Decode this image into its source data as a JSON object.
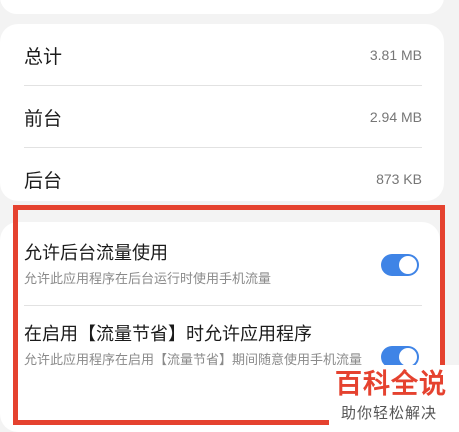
{
  "usage": {
    "rows": [
      {
        "label": "总计",
        "value": "3.81 MB"
      },
      {
        "label": "前台",
        "value": "2.94 MB"
      },
      {
        "label": "后台",
        "value": "873 KB"
      }
    ]
  },
  "settings": {
    "items": [
      {
        "title": "允许后台流量使用",
        "description": "允许此应用程序在后台运行时使用手机流量",
        "enabled": true
      },
      {
        "title": "在启用【流量节省】时允许应用程序",
        "description": "允许此应用程序在启用【流量节省】期间随意使用手机流量",
        "enabled": true
      }
    ]
  },
  "watermark": {
    "title": "百科全说",
    "subtitle": "助你轻松解决"
  },
  "colors": {
    "toggle_on": "#3f84e6",
    "highlight": "#e5422f",
    "background": "#f3f3f3"
  }
}
